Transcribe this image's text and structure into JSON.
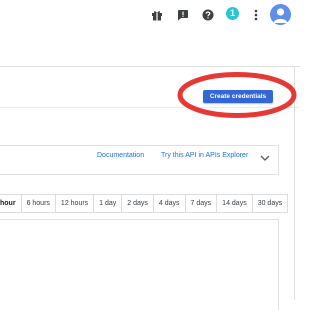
{
  "topbar": {
    "icons": [
      "gift-icon",
      "feedback-icon",
      "help-icon",
      "more-vert-icon",
      "avatar-icon"
    ],
    "notification_count": "1"
  },
  "credentials": {
    "button_label": "Create credentials",
    "accent_color": "#3367d6",
    "highlight_color": "#e53935"
  },
  "api_card": {
    "documentation_link": "Documentation",
    "try_api_link": "Try this API in APIs Explorer"
  },
  "time_range": {
    "options": [
      "hour",
      "6 hours",
      "12 hours",
      "1 day",
      "2 days",
      "4 days",
      "7 days",
      "14 days",
      "30 days"
    ],
    "selected": "hour"
  }
}
